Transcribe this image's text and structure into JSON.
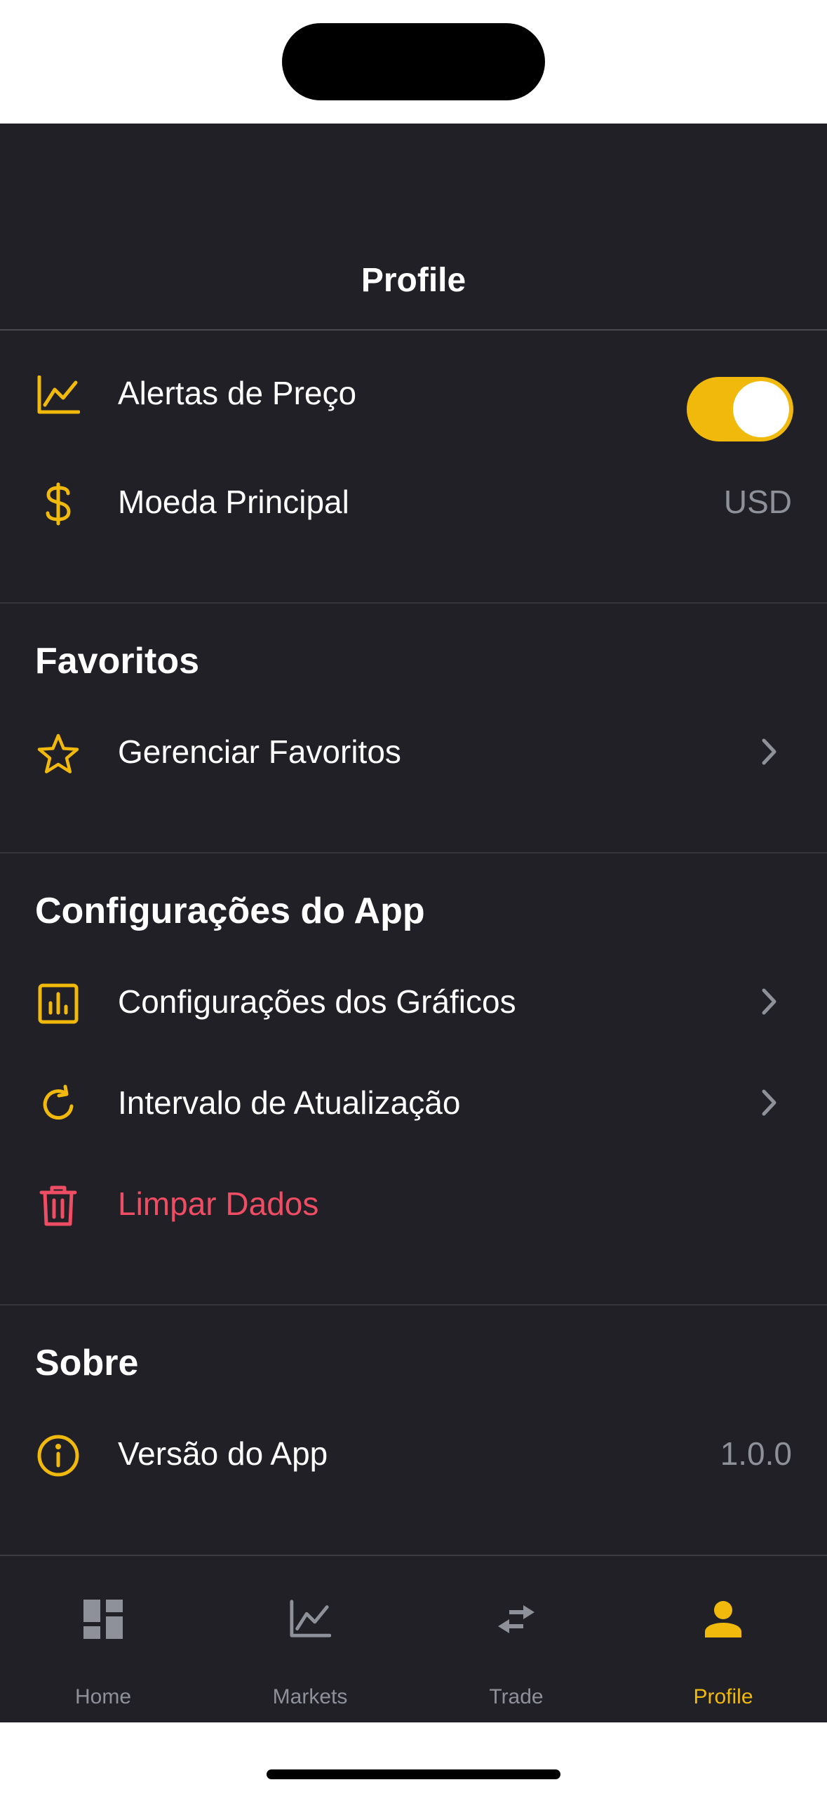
{
  "header": {
    "title": "Profile"
  },
  "general": {
    "price_alerts": {
      "label": "Alertas de Preço",
      "enabled": true,
      "icon": "chart-line-icon"
    },
    "main_currency": {
      "label": "Moeda Principal",
      "value": "USD",
      "icon": "dollar-icon"
    }
  },
  "favorites": {
    "title": "Favoritos",
    "manage": {
      "label": "Gerenciar Favoritos",
      "icon": "star-icon"
    }
  },
  "app_settings": {
    "title": "Configurações do App",
    "chart_settings": {
      "label": "Configurações dos Gráficos",
      "icon": "bar-chart-icon"
    },
    "refresh_interval": {
      "label": "Intervalo de Atualização",
      "icon": "refresh-icon"
    },
    "clear_data": {
      "label": "Limpar Dados",
      "icon": "trash-icon"
    }
  },
  "about": {
    "title": "Sobre",
    "version": {
      "label": "Versão do App",
      "value": "1.0.0",
      "icon": "info-icon"
    }
  },
  "tabs": [
    {
      "label": "Home",
      "icon": "dashboard-icon",
      "active": false
    },
    {
      "label": "Markets",
      "icon": "chart-line-icon",
      "active": false
    },
    {
      "label": "Trade",
      "icon": "swap-arrows-icon",
      "active": false
    },
    {
      "label": "Profile",
      "icon": "person-icon",
      "active": true
    }
  ],
  "colors": {
    "accent": "#f0b90b",
    "danger": "#ef4d64",
    "background": "#202026",
    "muted": "#8e909a"
  }
}
